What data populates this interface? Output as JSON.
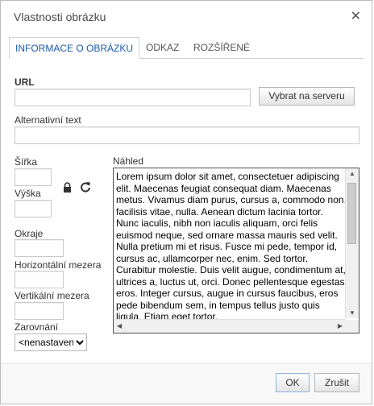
{
  "dialog": {
    "title": "Vlastnosti obrázku",
    "close_icon": "close-icon"
  },
  "tabs": [
    {
      "label": "INFORMACE O OBRÁZKU",
      "active": true
    },
    {
      "label": "ODKAZ",
      "active": false
    },
    {
      "label": "ROZŠÍŘENÉ",
      "active": false
    }
  ],
  "form": {
    "url_label": "URL",
    "url_value": "",
    "browse_button": "Vybrat na serveru",
    "alt_label": "Alternativní text",
    "alt_value": "",
    "width_label": "Šířka",
    "width_value": "",
    "height_label": "Výška",
    "height_value": "",
    "lock_icon": "lock-icon",
    "reset_icon": "reset-size-icon",
    "border_label": "Okraje",
    "border_value": "",
    "hspace_label": "Horizontální mezera",
    "hspace_value": "",
    "vspace_label": "Vertikální mezera",
    "vspace_value": "",
    "align_label": "Zarovnání",
    "align_selected": "<nenastaveno>"
  },
  "preview": {
    "label": "Náhled",
    "text": "Lorem ipsum dolor sit amet, consectetuer adipiscing elit. Maecenas feugiat consequat diam. Maecenas metus. Vivamus diam purus, cursus a, commodo non, facilisis vitae, nulla. Aenean dictum lacinia tortor. Nunc iaculis, nibh non iaculis aliquam, orci felis euismod neque, sed ornare massa mauris sed velit. Nulla pretium mi et risus. Fusce mi pede, tempor id, cursus ac, ullamcorper nec, enim. Sed tortor. Curabitur molestie. Duis velit augue, condimentum at, ultrices a, luctus ut, orci. Donec pellentesque egestas eros. Integer cursus, augue in cursus faucibus, eros pede bibendum sem, in tempus tellus justo quis ligula. Etiam eget tortor."
  },
  "footer": {
    "ok_label": "OK",
    "cancel_label": "Zrušit"
  }
}
